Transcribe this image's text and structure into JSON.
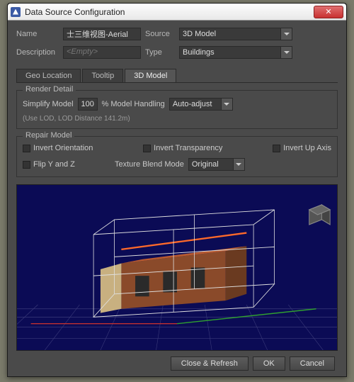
{
  "window": {
    "title": "Data Source Configuration"
  },
  "form": {
    "name_label": "Name",
    "name_value": "士三维视图-Aerial",
    "source_label": "Source",
    "source_value": "3D Model",
    "description_label": "Description",
    "description_placeholder": "<Empty>",
    "type_label": "Type",
    "type_value": "Buildings"
  },
  "tabs": {
    "geo": "Geo Location",
    "tooltip": "Tooltip",
    "model": "3D Model"
  },
  "render_detail": {
    "legend": "Render Detail",
    "simplify_label": "Simplify Model",
    "simplify_value": "100",
    "simplify_suffix": "% Model Handling",
    "handling_value": "Auto-adjust",
    "lod_hint": "(Use LOD, LOD Distance 141.2m)"
  },
  "repair_model": {
    "legend": "Repair Model",
    "invert_orientation": "Invert Orientation",
    "invert_transparency": "Invert Transparency",
    "invert_up_axis": "Invert Up Axis",
    "flip_yz": "Flip Y and Z",
    "texture_blend_label": "Texture Blend Mode",
    "texture_blend_value": "Original"
  },
  "footer": {
    "close_refresh": "Close & Refresh",
    "ok": "OK",
    "cancel": "Cancel"
  }
}
